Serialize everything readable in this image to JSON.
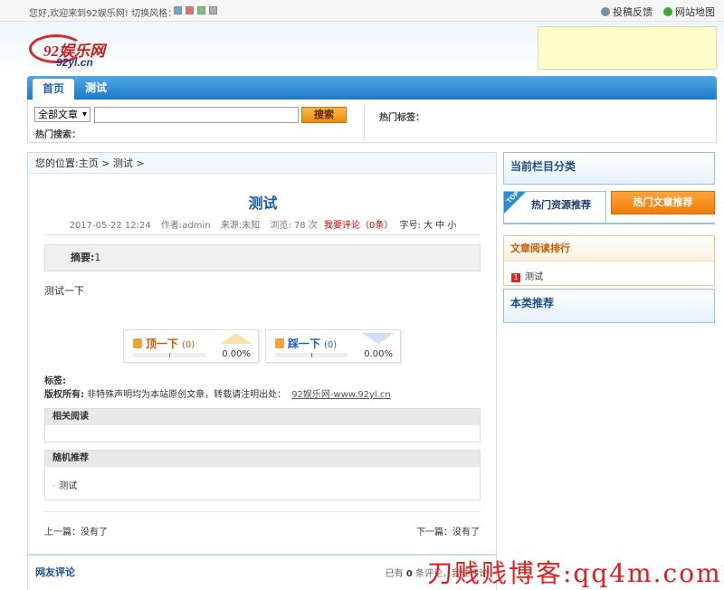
{
  "topbar": {
    "welcome": "您好,欢迎来到92娱乐网! 切换风格：",
    "skin_colors": [
      "#6aa7dc",
      "#e86d6d",
      "#7fc46f",
      "#b0b0b0"
    ],
    "links": [
      "投稿反馈",
      "网站地图"
    ]
  },
  "logo": {
    "line1": "92娱乐网",
    "line2": "92yl.cn"
  },
  "nav": {
    "items": [
      "首页",
      "测试"
    ]
  },
  "search": {
    "select_value": "全部文章",
    "input_value": "",
    "button": "搜索",
    "hot_search": "热门搜索：",
    "hot_tags": "热门标签："
  },
  "breadcrumb": "您的位置:主页 > 测试 >",
  "article": {
    "title": "测试",
    "date": "2017-05-22 12:24",
    "author": "作者:admin",
    "source": "来源:未知",
    "views": "浏览: 78 次",
    "comment_link": "我要评论（0条）",
    "font_size": "字号: 大 中 小",
    "summary_label": "摘要:",
    "summary_value": "1",
    "body": "测试一下"
  },
  "votes": {
    "up": {
      "label": "顶一下",
      "count": "(0)",
      "percent": "0.00%",
      "fraction": 0
    },
    "down": {
      "label": "踩一下",
      "count": "(0)",
      "percent": "0.00%",
      "fraction": 0
    }
  },
  "tags_label": "标签:",
  "copyright": {
    "label": "版权所有:",
    "text": " 非特殊声明均为本站原创文章，转载请注明出处：",
    "link": "92娱乐网-www.92yl.cn"
  },
  "related": {
    "title": "相关阅读"
  },
  "random": {
    "title": "随机推荐",
    "items": [
      "测试"
    ]
  },
  "pager": {
    "prev": "上一篇：没有了",
    "next": "下一篇：没有了"
  },
  "comments": {
    "title": "网友评论",
    "count_prefix": "已有",
    "count": "0",
    "count_suffix": "条评论，我要评论"
  },
  "sidebar": {
    "category_title": "当前栏目分类",
    "tab_hot_resources": "热门资源推荐",
    "tab_top_badge": "TOP",
    "tab_hot_articles": "热门文章推荐",
    "ranking_title": "文章阅读排行",
    "ranking_items": [
      {
        "num": "1",
        "title": "测试"
      }
    ],
    "same_category_title": "本类推荐"
  },
  "watermark": "刀贱贱博客:qq4m.com"
}
